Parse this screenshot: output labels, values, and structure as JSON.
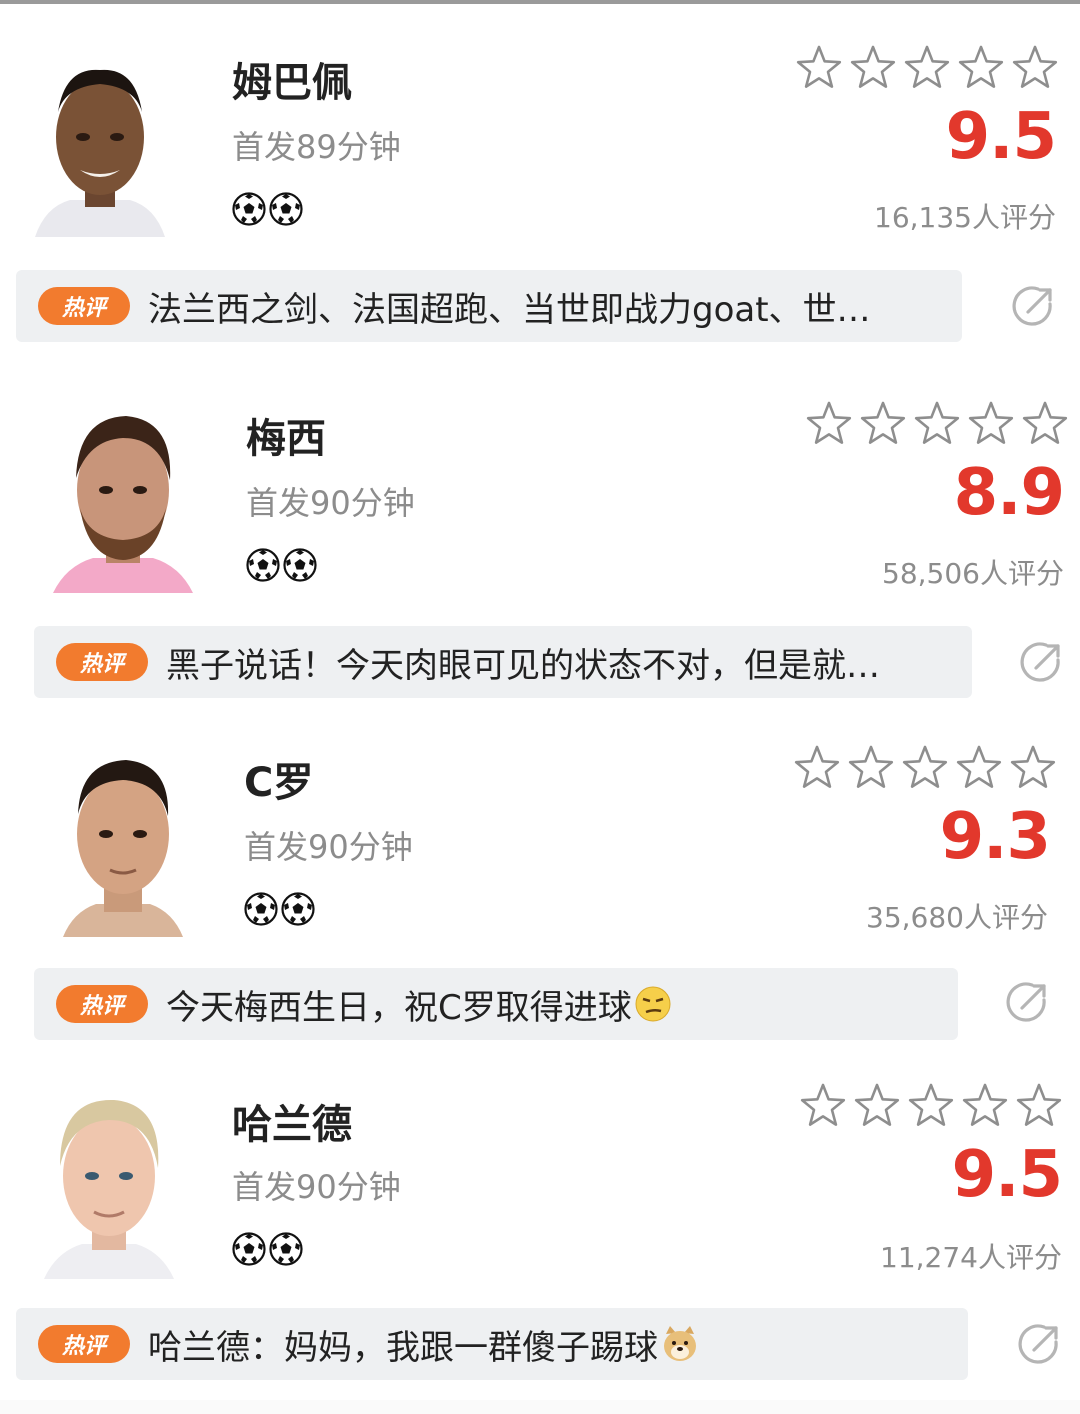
{
  "players": [
    {
      "name": "姆巴佩",
      "start_info": "首发89分钟",
      "goals": 2,
      "stars_filled": 0,
      "score": "9.5",
      "rating_count": "16,135人评分",
      "hot_label": "热评",
      "comment": "法兰西之剑、法国超跑、当世即战力goat、世…",
      "comment_emoji": "",
      "jersey_color": "#e9e9ee"
    },
    {
      "name": "梅西",
      "start_info": "首发90分钟",
      "goals": 2,
      "stars_filled": 0,
      "score": "8.9",
      "rating_count": "58,506人评分",
      "hot_label": "热评",
      "comment": "黑子说话！今天肉眼可见的状态不对，但是就…",
      "comment_emoji": "",
      "jersey_color": "#f3a9c8"
    },
    {
      "name": "C罗",
      "start_info": "首发90分钟",
      "goals": 2,
      "stars_filled": 0,
      "score": "9.3",
      "rating_count": "35,680人评分",
      "hot_label": "热评",
      "comment": "今天梅西生日，祝C罗取得进球",
      "comment_emoji": "smirk-emoji",
      "jersey_color": "#d9b59a"
    },
    {
      "name": "哈兰德",
      "start_info": "首发90分钟",
      "goals": 2,
      "stars_filled": 0,
      "score": "9.5",
      "rating_count": "11,274人评分",
      "hot_label": "热评",
      "comment": "哈兰德：妈妈，我跟一群傻子踢球",
      "comment_emoji": "doge-emoji",
      "jersey_color": "#eeeef2"
    }
  ],
  "colors": {
    "score": "#e2382c",
    "hot_badge": "#f27b2e",
    "comment_bg": "#eef0f2",
    "muted_text": "#8c8c8c"
  },
  "icons": {
    "star": "star-outline-icon",
    "goal": "soccer-ball-icon",
    "share": "share-arrow-icon"
  }
}
